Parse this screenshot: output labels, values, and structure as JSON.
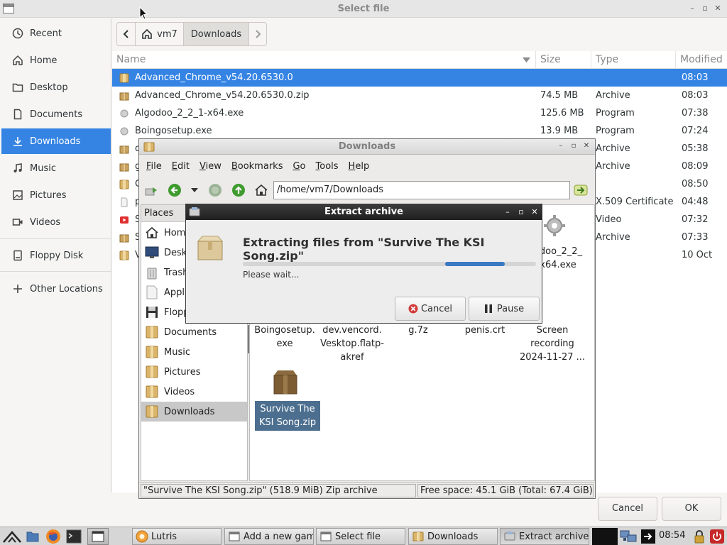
{
  "file_chooser": {
    "title": "Select file",
    "window_controls": [
      "–",
      "▫",
      "✕"
    ],
    "sidebar": {
      "items": [
        {
          "label": "Recent",
          "icon": "clock-icon"
        },
        {
          "label": "Home",
          "icon": "home-icon"
        },
        {
          "label": "Desktop",
          "icon": "folder-icon"
        },
        {
          "label": "Documents",
          "icon": "document-icon"
        },
        {
          "label": "Downloads",
          "icon": "download-icon",
          "active": true
        },
        {
          "label": "Music",
          "icon": "music-icon"
        },
        {
          "label": "Pictures",
          "icon": "picture-icon"
        },
        {
          "label": "Videos",
          "icon": "video-icon"
        },
        {
          "label": "Floppy Disk",
          "icon": "drive-icon"
        },
        {
          "label": "Other Locations",
          "icon": "plus-icon"
        }
      ]
    },
    "pathbar": {
      "back_icon": "chevron-left-icon",
      "segments": [
        "vm7",
        "Downloads"
      ],
      "forward_icon": "chevron-right-icon"
    },
    "columns": [
      "Name",
      "Size",
      "Type",
      "Modified"
    ],
    "files": [
      {
        "name": "Advanced_Chrome_v54.20.6530.0",
        "size": "",
        "type": "",
        "modified": "08:03",
        "icon": "folder-icon",
        "selected": true
      },
      {
        "name": "Advanced_Chrome_v54.20.6530.0.zip",
        "size": "74.5 MB",
        "type": "Archive",
        "modified": "08:03",
        "icon": "archive-icon"
      },
      {
        "name": "Algodoo_2_2_1-x64.exe",
        "size": "125.6 MB",
        "type": "Program",
        "modified": "07:38",
        "icon": "program-icon"
      },
      {
        "name": "Boingosetup.exe",
        "size": "13.9 MB",
        "type": "Program",
        "modified": "07:24",
        "icon": "program-icon"
      },
      {
        "name": "d",
        "size": "",
        "type": "Archive",
        "modified": "05:38",
        "icon": "archive-icon"
      },
      {
        "name": "g",
        "size": "",
        "type": "Archive",
        "modified": "08:09",
        "icon": "archive-icon"
      },
      {
        "name": "G",
        "size": "",
        "type": "",
        "modified": "08:50",
        "icon": "folder-icon"
      },
      {
        "name": "p",
        "size": "",
        "type": "X.509 Certificate",
        "modified": "04:48",
        "icon": "certificate-icon"
      },
      {
        "name": "S",
        "size": "",
        "type": "Video",
        "modified": "07:32",
        "icon": "video-icon"
      },
      {
        "name": "S",
        "size": "",
        "type": "Archive",
        "modified": "07:33",
        "icon": "archive-icon"
      },
      {
        "name": "V",
        "size": "",
        "type": "",
        "modified": "10 Oct",
        "icon": "folder-icon"
      }
    ],
    "buttons": {
      "cancel": "Cancel",
      "ok": "OK"
    }
  },
  "file_manager": {
    "title": "Downloads",
    "window_controls": [
      "–",
      "▫",
      "✕"
    ],
    "menu": [
      {
        "underline": "F",
        "rest": "ile"
      },
      {
        "underline": "E",
        "rest": "dit"
      },
      {
        "underline": "V",
        "rest": "iew"
      },
      {
        "underline": "B",
        "rest": "ookmarks"
      },
      {
        "underline": "G",
        "rest": "o"
      },
      {
        "underline": "T",
        "rest": "ools"
      },
      {
        "underline": "H",
        "rest": "elp"
      }
    ],
    "location": "/home/vm7/Downloads",
    "places_header": "Places",
    "places": [
      {
        "label": "Home",
        "icon": "home-icon"
      },
      {
        "label": "Desktop",
        "icon": "desktop-icon"
      },
      {
        "label": "Trash",
        "icon": "trash-icon"
      },
      {
        "label": "Applications",
        "icon": "applications-icon"
      },
      {
        "label": "Floppy",
        "icon": "floppy-icon"
      },
      {
        "label": "Documents",
        "icon": "folder-icon"
      },
      {
        "label": "Music",
        "icon": "folder-icon"
      },
      {
        "label": "Pictures",
        "icon": "folder-icon"
      },
      {
        "label": "Videos",
        "icon": "folder-icon"
      },
      {
        "label": "Downloads",
        "icon": "folder-icon",
        "active": true
      }
    ],
    "icons": [
      {
        "label_lines": [
          "odoo_2_2_",
          "x64.exe"
        ],
        "icon": "gear-icon"
      },
      {
        "label_lines": [
          "Boingosetup.",
          "exe"
        ],
        "icon": "program-icon"
      },
      {
        "label_lines": [
          "dev.vencord.",
          "Vesktop.flatp-",
          "akref"
        ],
        "icon": "file-icon"
      },
      {
        "label_lines": [
          "g.7z"
        ],
        "icon": "archive-icon"
      },
      {
        "label_lines": [
          "penis.crt"
        ],
        "icon": "certificate-icon"
      },
      {
        "label_lines": [
          "Screen",
          "recording",
          "2024-11-27 ..."
        ],
        "icon": "document-icon"
      },
      {
        "label_lines": [
          "Survive The",
          "KSI Song.zip"
        ],
        "icon": "archive-icon",
        "selected": true
      }
    ],
    "status": {
      "selection": "\"Survive The KSI Song.zip\" (518.9 MiB) Zip archive",
      "free_space": "Free space: 45.1 GiB (Total: 67.4 GiB)"
    }
  },
  "extract_dialog": {
    "title": "Extract archive",
    "window_controls": [
      "–",
      "▫",
      "✕"
    ],
    "heading": "Extracting files from \"Survive The KSI Song.zip\"",
    "status": "Please wait...",
    "cancel": "Cancel",
    "pause": "Pause"
  },
  "taskbar": {
    "tasks": [
      {
        "label": "Lutris",
        "icon": "lutris-icon"
      },
      {
        "label": "Add a new game",
        "icon": "window-icon"
      },
      {
        "label": "Select file",
        "icon": "window-icon"
      },
      {
        "label": "Downloads",
        "icon": "folder-icon"
      },
      {
        "label": "Extract archive",
        "icon": "archive-icon",
        "active": true
      }
    ],
    "clock": "08:54"
  },
  "colors": {
    "accent": "#3584e4",
    "progress": "#3b78c4",
    "dialog_titlebar": "#2a2a2a"
  }
}
